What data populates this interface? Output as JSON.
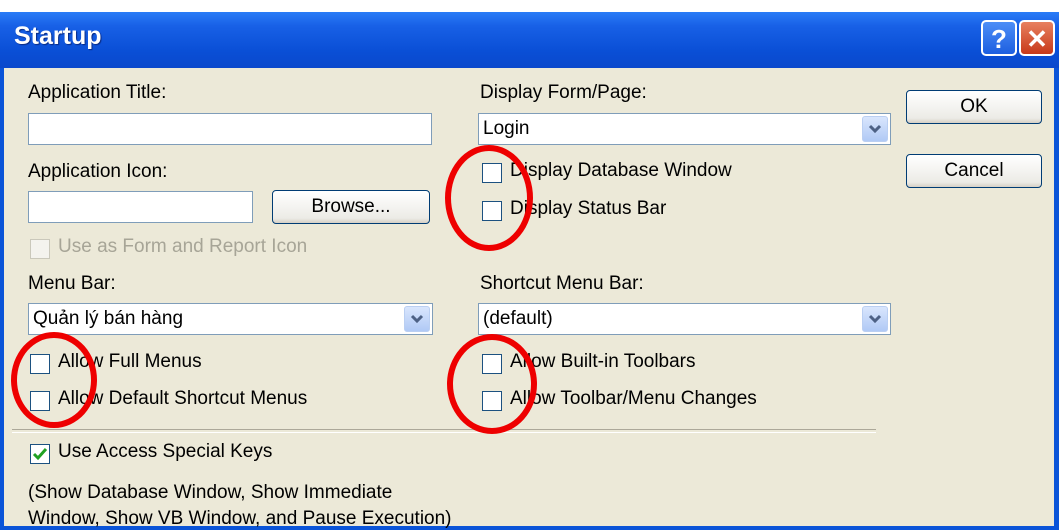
{
  "window": {
    "title": "Startup",
    "help_glyph": "?",
    "close_glyph": "✕"
  },
  "left": {
    "app_title_label": "Application Title:",
    "app_title_value": "",
    "app_icon_label": "Application Icon:",
    "app_icon_value": "",
    "browse_label": "Browse...",
    "use_as_icon_label": "Use as Form and Report Icon",
    "menu_bar_label": "Menu Bar:",
    "menu_bar_value": "Quản lý bán hàng",
    "allow_full_menus_label": "Allow Full Menus",
    "allow_default_shortcut_label": "Allow Default Shortcut Menus"
  },
  "right": {
    "display_form_label": "Display Form/Page:",
    "display_form_value": "Login",
    "display_db_window_label": "Display Database Window",
    "display_status_bar_label": "Display Status Bar",
    "shortcut_menu_bar_label": "Shortcut Menu Bar:",
    "shortcut_menu_bar_value": "(default)",
    "allow_builtin_toolbars_label": "Allow Built-in Toolbars",
    "allow_toolbar_changes_label": "Allow Toolbar/Menu Changes"
  },
  "buttons": {
    "ok": "OK",
    "cancel": "Cancel"
  },
  "special_keys": {
    "label": "Use Access Special Keys",
    "checked": true,
    "note_line1": "(Show Database Window, Show Immediate",
    "note_line2": "Window, Show VB Window, and Pause Execution)"
  },
  "colors": {
    "title_bar": "#0a54d8",
    "dialog_bg": "#ece9d8",
    "highlight_circle": "#ee0000",
    "check_green": "#21a121"
  }
}
